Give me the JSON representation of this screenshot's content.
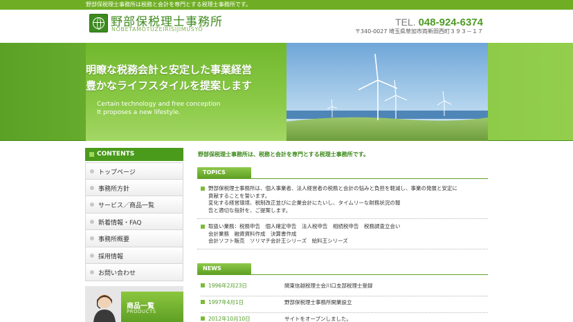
{
  "top_bar": {
    "tagline": "野部保税理士事務所は税務と会計を専門とする税理士事務所です。"
  },
  "header": {
    "office_name": "野部保税理士事務所",
    "office_name_roman": "NOBETAMOTUZEIRISIJIMUSYO",
    "tel_label": "TEL.",
    "tel_number": "048-924-6374",
    "address": "〒340-0027 埼玉県草加市両新田西町３９３－１７"
  },
  "hero": {
    "headline_1": "明瞭な税務会計と安定した事業経営",
    "headline_2": "豊かなライフスタイルを提案します",
    "english_1": "Certain technology and free conception",
    "english_2": "It proposes a new lifestyle."
  },
  "sidebar": {
    "title": "CONTENTS",
    "items": [
      {
        "label": "トップページ"
      },
      {
        "label": "事務所方針"
      },
      {
        "label": "サービス／商品一覧"
      },
      {
        "label": "新着情報・FAQ"
      },
      {
        "label": "事務所概要"
      },
      {
        "label": "採用情報"
      },
      {
        "label": "お問い合わせ"
      }
    ],
    "banner_title": "商品一覧",
    "banner_subtitle": "PRODUCTS"
  },
  "main": {
    "intro": "野部保税理士事務所は、税務と会計を専門とする税理士事務所です。",
    "topics_title": "TOPICS",
    "topics": [
      {
        "lines": [
          "野部保税理士事務所は、個人事業者、法人経営者の税務と会計の悩みと負担を軽減し、事業の発展と安定に",
          "貢献することを誓います。",
          "変化する経営環境、税制改正並びに企業会計にたいし、タイムリーな財務状況の報",
          "告と適切な指針を、ご提案します。"
        ]
      },
      {
        "lines": [
          "取扱い業務：税務申告　個人確定申告　法人税申告　相続税申告　税務調査立会い",
          "会計業務　融資資料作成　決算書作成",
          "会計ソフト販売　ソリマチ会計王シリーズ　給料王シリーズ"
        ]
      }
    ],
    "news_title": "NEWS",
    "news": [
      {
        "date": "1996年2月23日",
        "text": "関東信越税理士会川口支部税理士登録"
      },
      {
        "date": "1997年4月1日",
        "text": "野部保税理士事務所開業設立"
      },
      {
        "date": "2012年10月10日",
        "text": "サイトをオープンしました。"
      }
    ]
  },
  "colors": {
    "brand_green": "#4a9a1c",
    "accent_green": "#7cbb3a",
    "tel_green": "#4e9b22"
  }
}
